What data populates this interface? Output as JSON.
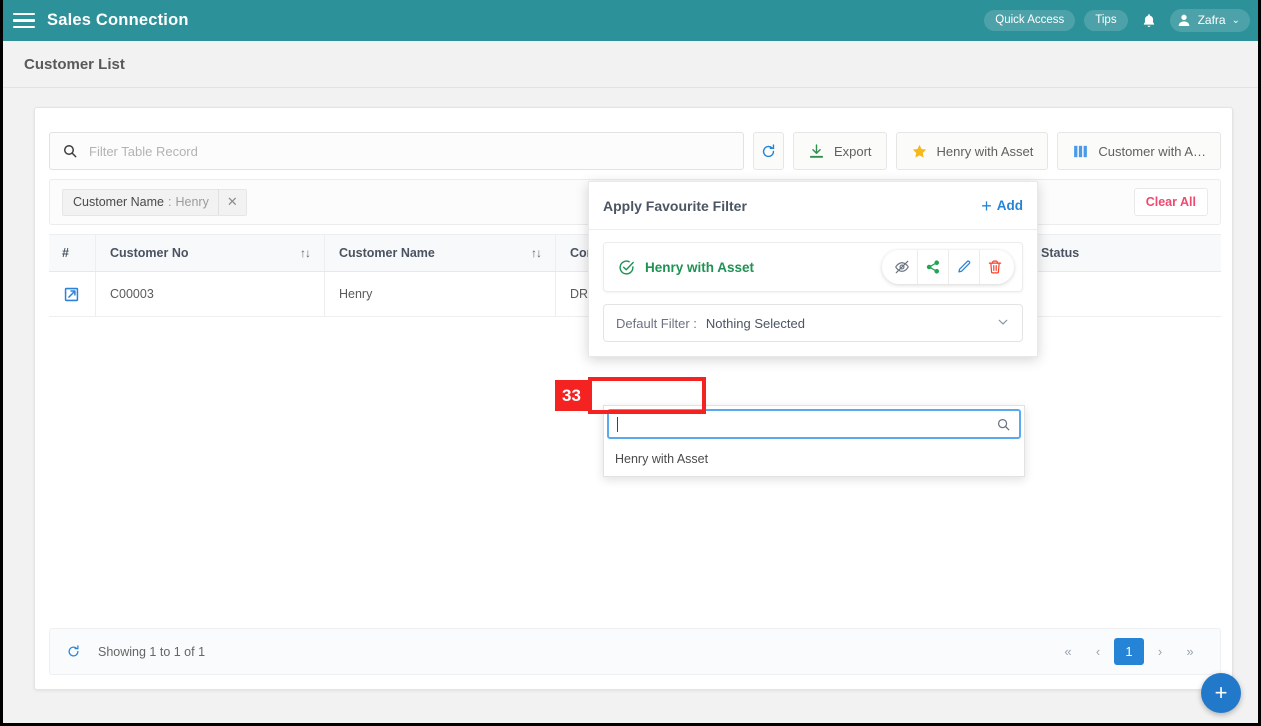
{
  "topbar": {
    "menu_icon": "hamburger-icon",
    "app_title": "Sales Connection",
    "quick_access": "Quick Access",
    "tips": "Tips",
    "bell_icon": "bell-icon",
    "user_name": "Zafra",
    "user_caret": "⌄",
    "bg_color": "#2c9199"
  },
  "page": {
    "title": "Customer List"
  },
  "toolbar": {
    "search_placeholder": "Filter Table Record",
    "search_value": "",
    "search_icon": "search-icon",
    "refresh_label": "",
    "refresh_icon": "refresh-icon",
    "export_label": "Export",
    "export_icon": "download-icon",
    "favourite_label": "Henry with Asset",
    "favourite_icon": "star-icon",
    "columns_label": "Customer with A…",
    "columns_icon": "columns-icon"
  },
  "filters": {
    "chip_key": "Customer Name",
    "chip_sep": ":",
    "chip_value": "Henry",
    "chip_close": "✕",
    "clear_all": "Clear All"
  },
  "table": {
    "columns": [
      {
        "label": "#",
        "sortable": false
      },
      {
        "label": "Customer No",
        "sortable": true
      },
      {
        "label": "Customer Name",
        "sortable": true
      },
      {
        "label": "Com",
        "sortable": false
      },
      {
        "label": "",
        "sortable": false
      },
      {
        "label": "Status",
        "sortable": false
      }
    ],
    "sort_icon": "↑↓",
    "rows": [
      {
        "open_icon": "external-link-icon",
        "customer_no": "C00003",
        "customer_name": "Henry",
        "company": "DRC",
        "extra": "",
        "status": ""
      }
    ]
  },
  "footer": {
    "refresh_icon": "refresh-icon",
    "showing": "Showing 1 to 1 of 1",
    "pager": {
      "first": "«",
      "prev": "‹",
      "pages": [
        "1"
      ],
      "active_page": "1",
      "next": "›",
      "last": "»"
    }
  },
  "fab": {
    "label": "+",
    "color": "#2379c9"
  },
  "favourite_panel": {
    "title": "Apply Favourite Filter",
    "add_label": "Add",
    "add_plus": "+",
    "item": {
      "name": "Henry with Asset",
      "check_icon": "check-circle-icon",
      "actions": [
        {
          "name": "hide-icon",
          "title": ""
        },
        {
          "name": "share-icon",
          "title": ""
        },
        {
          "name": "edit-icon",
          "title": ""
        },
        {
          "name": "delete-icon",
          "title": ""
        }
      ]
    },
    "default_filter": {
      "label": "Default Filter :",
      "value": "Nothing Selected",
      "chevron": "⌄"
    },
    "dropdown": {
      "search_value": "",
      "search_icon": "search-icon",
      "options": [
        "Henry with Asset"
      ]
    }
  },
  "annotation": {
    "badge": "33",
    "color": "#f52222"
  }
}
